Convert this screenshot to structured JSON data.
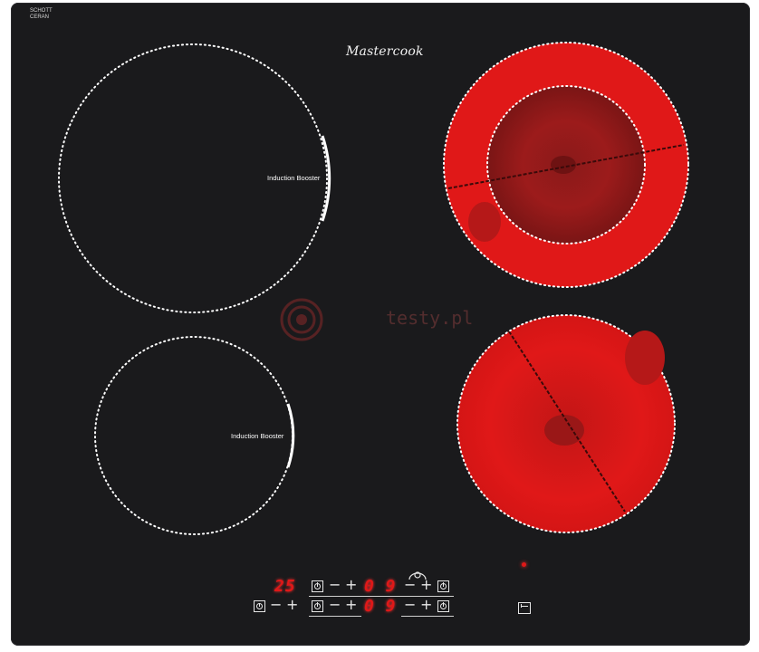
{
  "brand": {
    "logo_text": "Mastercook",
    "glass_maker": "SCHOTT CERAN"
  },
  "watermark": {
    "text": "testy.pl"
  },
  "zones": {
    "front_left": {
      "label": "Induction Booster"
    },
    "rear_left": {
      "label": "Induction Booster"
    }
  },
  "controls": {
    "timer_display": "25",
    "rear_display": "0 9",
    "front_display": "0 9",
    "minus_symbol": "−",
    "plus_symbol": "+"
  },
  "colors": {
    "glass": "#1a1a1c",
    "hot_zone": "#e01818",
    "led": "#e01818",
    "print": "#ffffff"
  },
  "icons": {
    "power": "power-icon",
    "timer": "timer-icon",
    "lock": "key-lock-icon",
    "booster": "booster-icon"
  }
}
